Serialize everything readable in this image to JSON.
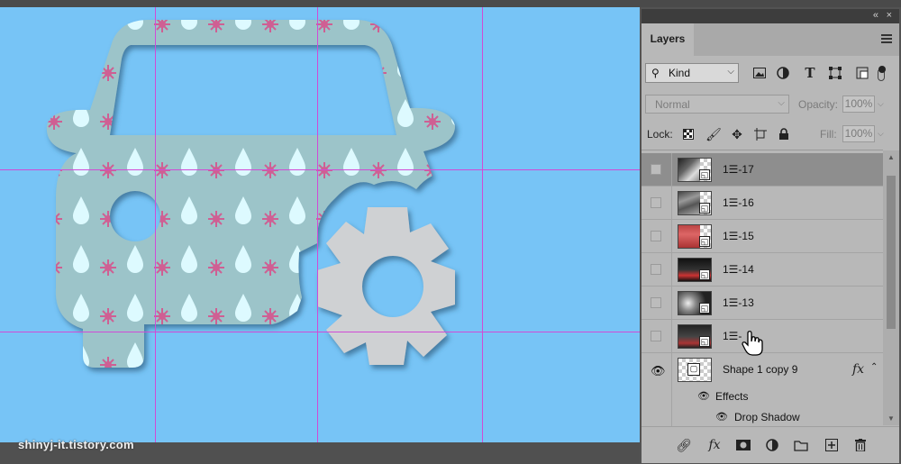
{
  "canvas": {
    "background": "#77c4f6",
    "watermark": "shinyj-it.tistory.com"
  },
  "panel": {
    "tab_label": "Layers",
    "collapse_icon": "«",
    "close_icon": "×",
    "menu_icon": "panel-menu-icon",
    "filter": {
      "kind_label": "Kind",
      "icons": [
        "image-filter-icon",
        "adjustment-filter-icon",
        "type-filter-icon",
        "shape-filter-icon",
        "smart-object-filter-icon"
      ]
    },
    "blend": {
      "mode": "Normal",
      "opacity_label": "Opacity:",
      "opacity_value": "100%"
    },
    "lock": {
      "label": "Lock:",
      "fill_label": "Fill:",
      "fill_value": "100%"
    },
    "layers": [
      {
        "name": "1☰-17",
        "selected": true
      },
      {
        "name": "1☰-16",
        "selected": false
      },
      {
        "name": "1☰-15",
        "selected": false
      },
      {
        "name": "1☰-14",
        "selected": false
      },
      {
        "name": "1☰-13",
        "selected": false
      },
      {
        "name": "1☰-",
        "selected": false
      }
    ],
    "shape_layer": {
      "name": "Shape 1 copy 9",
      "fx": "fx",
      "effects_label": "Effects",
      "effect_name": "Drop Shadow"
    },
    "bottom_icons": [
      "link-icon",
      "fx-icon",
      "mask-icon",
      "adjustment-icon",
      "folder-icon",
      "new-layer-icon",
      "trash-icon"
    ]
  }
}
